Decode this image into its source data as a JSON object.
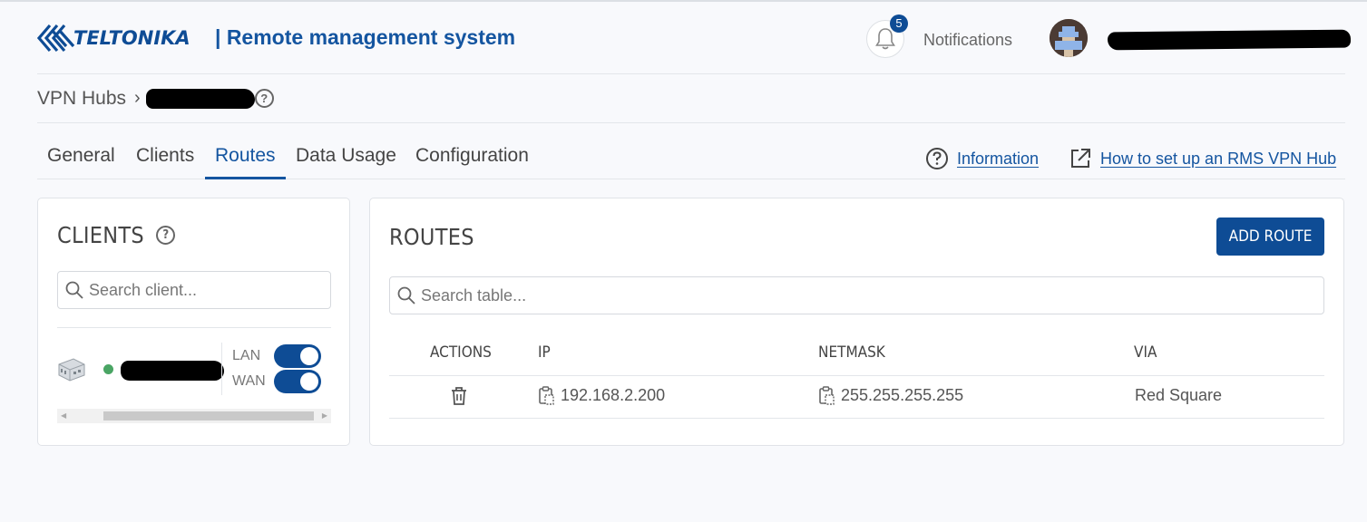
{
  "header": {
    "brand": "TELTONIKA",
    "app_title": "| Remote management system",
    "notifications_count": "5",
    "notifications_label": "Notifications"
  },
  "breadcrumb": {
    "root": "VPN Hubs",
    "separator": "›"
  },
  "tabs": [
    {
      "label": "General",
      "active": false
    },
    {
      "label": "Clients",
      "active": false
    },
    {
      "label": "Routes",
      "active": true
    },
    {
      "label": "Data Usage",
      "active": false
    },
    {
      "label": "Configuration",
      "active": false
    }
  ],
  "links": {
    "information": "Information",
    "how_to": "How to set up an RMS VPN Hub"
  },
  "clients_panel": {
    "title": "CLIENTS",
    "search_placeholder": "Search client...",
    "lan_label": "LAN",
    "wan_label": "WAN",
    "lan_enabled": true,
    "wan_enabled": true,
    "status_color": "#4aa564"
  },
  "routes_panel": {
    "title": "ROUTES",
    "add_button": "ADD ROUTE",
    "search_placeholder": "Search table...",
    "columns": [
      "ACTIONS",
      "IP",
      "NETMASK",
      "VIA"
    ],
    "rows": [
      {
        "ip": "192.168.2.200",
        "netmask": "255.255.255.255",
        "via": "Red Square"
      }
    ]
  },
  "colors": {
    "brand": "#0e4c95",
    "link": "#1455a0",
    "background": "#f8f9fc"
  }
}
